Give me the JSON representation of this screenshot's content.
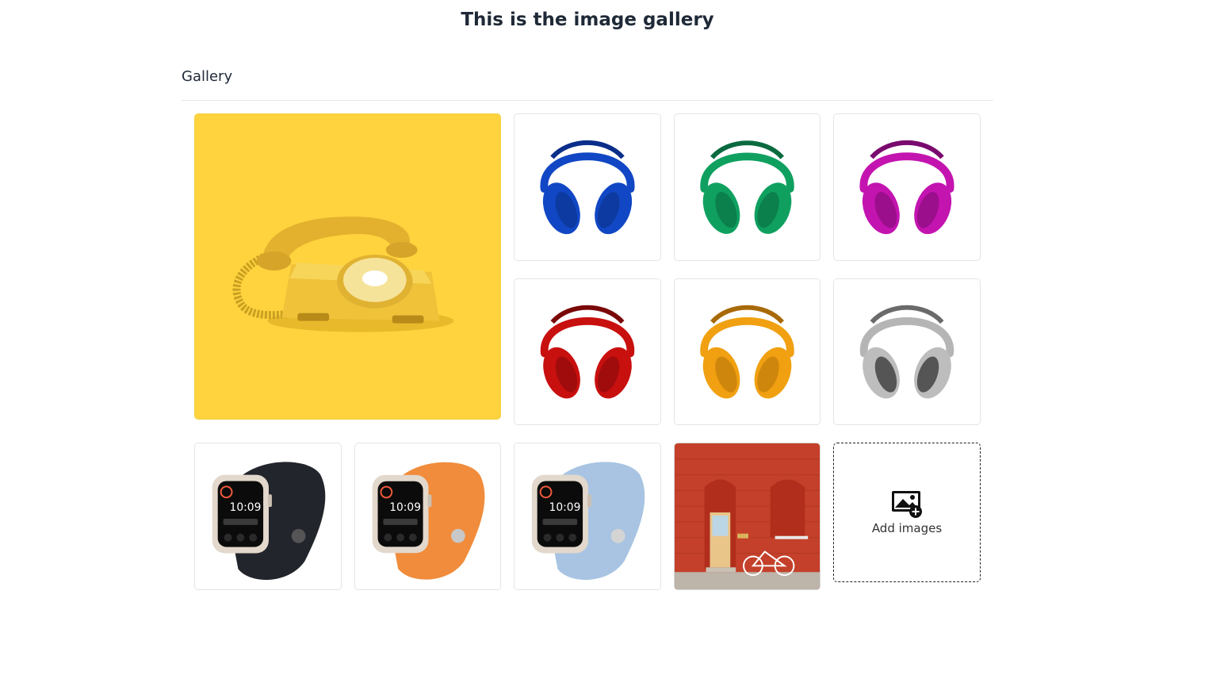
{
  "page": {
    "title": "This is the image gallery"
  },
  "gallery": {
    "heading": "Gallery",
    "add_label": "Add images",
    "headphone_colors": {
      "blue": "#1147c4",
      "green": "#0fa060",
      "magenta": "#c314b0",
      "red": "#c8100f",
      "orange": "#f0a010",
      "gray": "#8a8a8a"
    },
    "watch": {
      "time": "10:09",
      "band_colors": {
        "black": "#22252b",
        "orange": "#f08c3c",
        "lightblue": "#a8c4e2"
      }
    },
    "phone_background": "#fed33d",
    "wall_color": "#c4402a"
  }
}
